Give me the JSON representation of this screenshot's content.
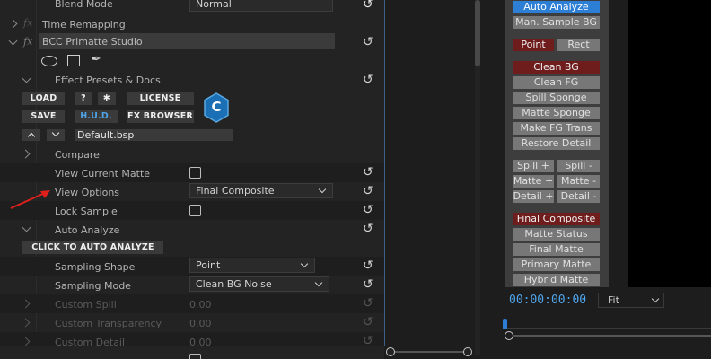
{
  "effect_controls": {
    "blend_mode": {
      "label": "Blend Mode",
      "value": "Normal"
    },
    "time_remapping": {
      "label": "Time Remapping"
    },
    "effect_name": "BCC Primatte Studio",
    "presets": {
      "section_label": "Effect Presets & Docs",
      "load": "LOAD",
      "help": "?",
      "gear": "✱",
      "license": "LICENSE",
      "save": "SAVE",
      "hud": "H.U.D.",
      "fx_browser": "FX BROWSER",
      "preset_file": "Default.bsp",
      "logo_letter": "C"
    },
    "compare": {
      "label": "Compare"
    },
    "view_current_matte": {
      "label": "View Current Matte",
      "checked": false
    },
    "view_options": {
      "label": "View Options",
      "value": "Final Composite"
    },
    "lock_sample": {
      "label": "Lock Sample",
      "checked": false
    },
    "auto_analyze": {
      "label": "Auto Analyze",
      "button": "CLICK TO AUTO ANALYZE",
      "sampling_shape": {
        "label": "Sampling Shape",
        "value": "Point"
      },
      "sampling_mode": {
        "label": "Sampling Mode",
        "value": "Clean BG Noise"
      }
    },
    "custom_spill": {
      "label": "Custom Spill",
      "value": "0.00"
    },
    "custom_transparency": {
      "label": "Custom Transparency",
      "value": "0.00"
    },
    "custom_detail": {
      "label": "Custom Detail",
      "value": "0.00"
    }
  },
  "bcc_buttons": {
    "auto_analyze": "Auto Analyze",
    "man_sample_bg": "Man. Sample BG",
    "point": "Point",
    "rect": "Rect",
    "clean_bg": "Clean BG",
    "clean_fg": "Clean FG",
    "spill_sponge": "Spill Sponge",
    "matte_sponge": "Matte Sponge",
    "make_fg_trans": "Make FG Trans",
    "restore_detail": "Restore Detail",
    "spill_plus": "Spill +",
    "spill_minus": "Spill -",
    "matte_plus": "Matte +",
    "matte_minus": "Matte -",
    "detail_plus": "Detail +",
    "detail_minus": "Detail -",
    "final_composite": "Final Composite",
    "matte_status": "Matte Status",
    "final_matte": "Final Matte",
    "primary_matte": "Primary Matte",
    "hybrid_matte": "Hybrid Matte"
  },
  "viewer": {
    "timecode": "00:00:00:00",
    "zoom": "Fit"
  },
  "colors": {
    "accent_blue": "#2d7fd6",
    "active_red": "#6e1c1c",
    "annotation_red": "#e0201b"
  }
}
